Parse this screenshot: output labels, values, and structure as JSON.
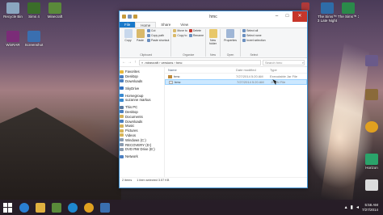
{
  "desktop": {
    "left_icons": [
      {
        "label": "Recycle Bin",
        "color": "#8aa6c0"
      },
      {
        "label": "Sims 4",
        "color": "#3b6d2a"
      },
      {
        "label": "Minecraft",
        "color": "#5a8a3a"
      },
      {
        "label": "WinRAR",
        "color": "#7b2c78"
      },
      {
        "label": "Screenshot",
        "color": "#3a6fb0"
      }
    ],
    "right_icons": [
      {
        "label": "The Sims™ 3 Late Night",
        "color": "#2e6ca8"
      },
      {
        "label": "The Sims™ 3",
        "color": "#2a8a4a"
      },
      {
        "label": "Google Chrome",
        "color": "#e0a020"
      },
      {
        "label": "Horizon",
        "color": "#2aa36a"
      }
    ]
  },
  "window": {
    "title": "hmc",
    "ribbon_tabs": [
      "File",
      "Home",
      "Share",
      "View"
    ],
    "ribbon": {
      "clipboard": {
        "copy": "Copy",
        "paste": "Paste",
        "cut": "Cut",
        "copy_path": "Copy path",
        "paste_shortcut": "Paste shortcut",
        "group": "Clipboard"
      },
      "organize": {
        "move_to": "Move to",
        "copy_to": "Copy to",
        "delete": "Delete",
        "rename": "Rename",
        "group": "Organize"
      },
      "new": {
        "new_folder": "New folder",
        "group": "New"
      },
      "open": {
        "properties": "Properties",
        "group": "Open"
      },
      "select": {
        "select_all": "Select all",
        "select_none": "Select none",
        "invert": "Invert selection",
        "group": "Select"
      }
    },
    "address": {
      "path": "« .minecraft › versions › hmc",
      "search_placeholder": "Search hmc"
    },
    "nav_pane": [
      {
        "label": "Favorites",
        "color": "#e8b93a",
        "gap": false
      },
      {
        "label": "Desktop",
        "color": "#4a7fc1",
        "gap": false
      },
      {
        "label": "Downloads",
        "color": "#4a7fc1",
        "gap": false
      },
      {
        "label": "SkyDrive",
        "color": "#2f6fc0",
        "gap": true
      },
      {
        "label": "Homegroup",
        "color": "#3a8ad0",
        "gap": true
      },
      {
        "label": "suzanne markus",
        "color": "#3a8ad0",
        "gap": false
      },
      {
        "label": "This PC",
        "color": "#5a7aa0",
        "gap": true
      },
      {
        "label": "Desktop",
        "color": "#4a7fc1",
        "gap": false
      },
      {
        "label": "Documents",
        "color": "#d6b45a",
        "gap": false
      },
      {
        "label": "Downloads",
        "color": "#4a7fc1",
        "gap": false
      },
      {
        "label": "Music",
        "color": "#d6b45a",
        "gap": false
      },
      {
        "label": "Pictures",
        "color": "#d6b45a",
        "gap": false
      },
      {
        "label": "Videos",
        "color": "#d6b45a",
        "gap": false
      },
      {
        "label": "Windows (C:)",
        "color": "#8a9bb0",
        "gap": false
      },
      {
        "label": "RECOVERY (D:)",
        "color": "#8a9bb0",
        "gap": false
      },
      {
        "label": "DVD RW Drive (E:)",
        "color": "#8a9bb0",
        "gap": false
      },
      {
        "label": "Network",
        "color": "#4a7fc1",
        "gap": true
      }
    ],
    "columns": {
      "name": "Name",
      "date": "Date modified",
      "type": "Type"
    },
    "files": [
      {
        "name": "hmc",
        "date": "7/27/2014 5:20 AM",
        "type": "Executable Jar File",
        "selected": false
      },
      {
        "name": "hmc",
        "date": "7/27/2014 5:20 AM",
        "type": "JSON File",
        "selected": true
      }
    ],
    "status": {
      "count": "2 items",
      "selection": "1 item selected  3.57 KB"
    }
  },
  "taskbar": {
    "apps": [
      {
        "name": "start",
        "color": "#ffffff"
      },
      {
        "name": "internet-explorer",
        "color": "#2a7fd4"
      },
      {
        "name": "file-explorer",
        "color": "#e0b040"
      },
      {
        "name": "minecraft",
        "color": "#5a8a3a"
      },
      {
        "name": "hp",
        "color": "#1e88d0"
      },
      {
        "name": "chrome",
        "color": "#e0a020"
      },
      {
        "name": "screenshot",
        "color": "#3a6fb0"
      }
    ],
    "time": "5:56 AM",
    "date": "7/27/2014"
  }
}
